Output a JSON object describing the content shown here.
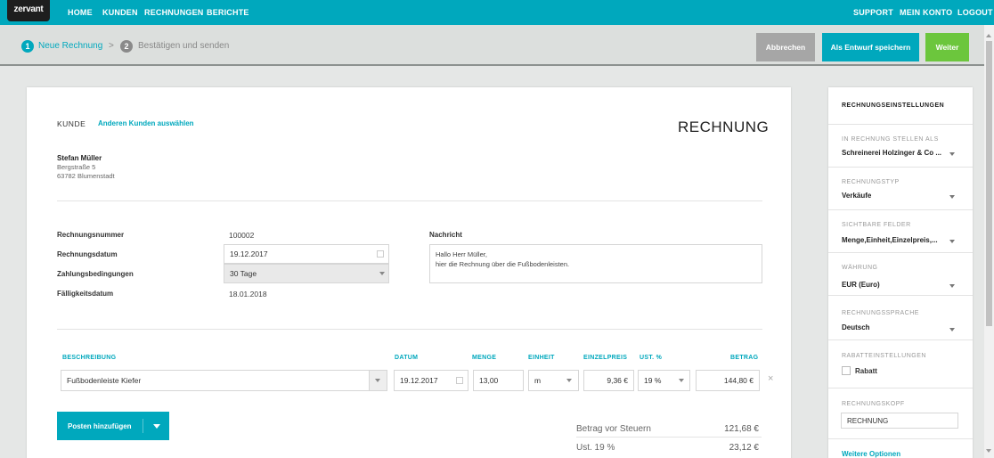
{
  "nav": {
    "logo": "zervant",
    "home": "HOME",
    "customers": "KUNDEN",
    "invoices": "RECHNUNGEN",
    "reports": "BERICHTE",
    "support": "SUPPORT",
    "account": "MEIN KONTO",
    "logout": "LOGOUT"
  },
  "steps": [
    {
      "num": "1",
      "label": "Neue Rechnung"
    },
    {
      "num": "2",
      "label": "Bestätigen und senden"
    }
  ],
  "step_separator": ">",
  "actions": {
    "cancel": "Abbrechen",
    "draft": "Als Entwurf speichern",
    "next": "Weiter"
  },
  "customer": {
    "label": "KUNDE",
    "change": "Anderen Kunden auswählen",
    "name": "Stefan Müller",
    "street": "Bergstraße 5",
    "city": "63782 Blumenstadt"
  },
  "doc_title": "RECHNUNG",
  "fields": {
    "number_label": "Rechnungsnummer",
    "number": "100002",
    "date_label": "Rechnungsdatum",
    "date": "19.12.2017",
    "terms_label": "Zahlungsbedingungen",
    "terms": "30 Tage",
    "due_label": "Fälligkeitsdatum",
    "due": "18.01.2018",
    "message_label": "Nachricht",
    "message_line1": "Hallo Herr Müller,",
    "message_line2": "hier die Rechnung über die Fußbodenleisten."
  },
  "items_header": {
    "desc": "BESCHREIBUNG",
    "date": "DATUM",
    "qty": "MENGE",
    "unit": "EINHEIT",
    "price": "EINZELPREIS",
    "vat": "UST. %",
    "amount": "BETRAG"
  },
  "item": {
    "desc": "Fußbodenleiste Kiefer",
    "date": "19.12.2017",
    "qty": "13,00",
    "unit": "m",
    "price": "9,36 €",
    "vat": "19 %",
    "amount": "144,80 €",
    "remove": "×"
  },
  "add_item": "Posten hinzufügen",
  "totals": {
    "pre_tax_label": "Betrag vor Steuern",
    "pre_tax": "121,68 €",
    "vat_label": "Ust. 19 %",
    "vat": "23,12 €"
  },
  "sidebar": {
    "title": "RECHNUNGSEINSTELLUNGEN",
    "issue_as_label": "IN RECHNUNG STELLEN ALS",
    "issue_as": "Schreinerei Holzinger & Co ...",
    "type_label": "RECHNUNGSTYP",
    "type": "Verkäufe",
    "fields_label": "SICHTBARE FELDER",
    "fields": "Menge,Einheit,Einzelpreis,...",
    "currency_label": "WÄHRUNG",
    "currency": "EUR (Euro)",
    "language_label": "RECHNUNGSSPRACHE",
    "language": "Deutsch",
    "discount_label": "RABATTEINSTELLUNGEN",
    "discount": "Rabatt",
    "header_label": "RECHNUNGSKOPF",
    "header_value": "RECHNUNG",
    "more": "Weitere Optionen"
  },
  "colors": {
    "accent": "#00a8bd",
    "green": "#6cc63d",
    "grey_btn": "#a6a6a6"
  }
}
